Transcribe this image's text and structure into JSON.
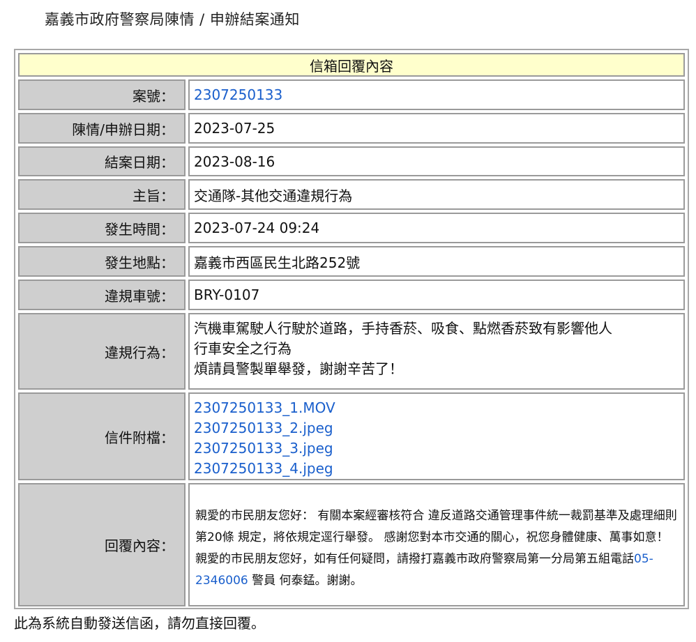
{
  "page": {
    "title": "嘉義市政府警察局陳情 / 申辦結案通知",
    "footer": "此為系統自動發送信函，請勿直接回覆。"
  },
  "table": {
    "header": "信箱回覆內容",
    "case_no": {
      "label": "案號：",
      "value": "2307250133"
    },
    "apply_date": {
      "label": "陳情/申辦日期：",
      "value": "2023-07-25"
    },
    "close_date": {
      "label": "結案日期：",
      "value": "2023-08-16"
    },
    "subject": {
      "label": "主旨：",
      "value": "交通隊-其他交通違規行為"
    },
    "occur_time": {
      "label": "發生時間：",
      "value": "2023-07-24 09:24"
    },
    "occur_place": {
      "label": "發生地點：",
      "value": "嘉義市西區民生北路252號"
    },
    "plate": {
      "label": "違規車號：",
      "value": "BRY-0107"
    },
    "behavior": {
      "label": "違規行為：",
      "line1": "汽機車駕駛人行駛於道路，手持香菸、吸食、點燃香菸致有影響他人",
      "line2": "行車安全之行為",
      "line3": "煩請員警製單舉發，謝謝辛苦了！"
    },
    "attachments": {
      "label": "信件附檔：",
      "files": [
        "2307250133_1.MOV",
        "2307250133_2.jpeg",
        "2307250133_3.jpeg",
        "2307250133_4.jpeg"
      ]
    },
    "reply": {
      "label": "回覆內容：",
      "text_before": "親愛的市民朋友您好： 有關本案經審核符合 違反道路交通管理事件統一裁罰基準及處理細則第20條 規定，將依規定逕行舉發。 感謝您對本市交通的關心，祝您身體健康、萬事如意！ 親愛的市民朋友您好，如有任何疑問，請撥打嘉義市政府警察局第一分局第五組電話",
      "phone": "05-2346006",
      "text_after": " 警員 何泰錳。謝謝。"
    }
  }
}
